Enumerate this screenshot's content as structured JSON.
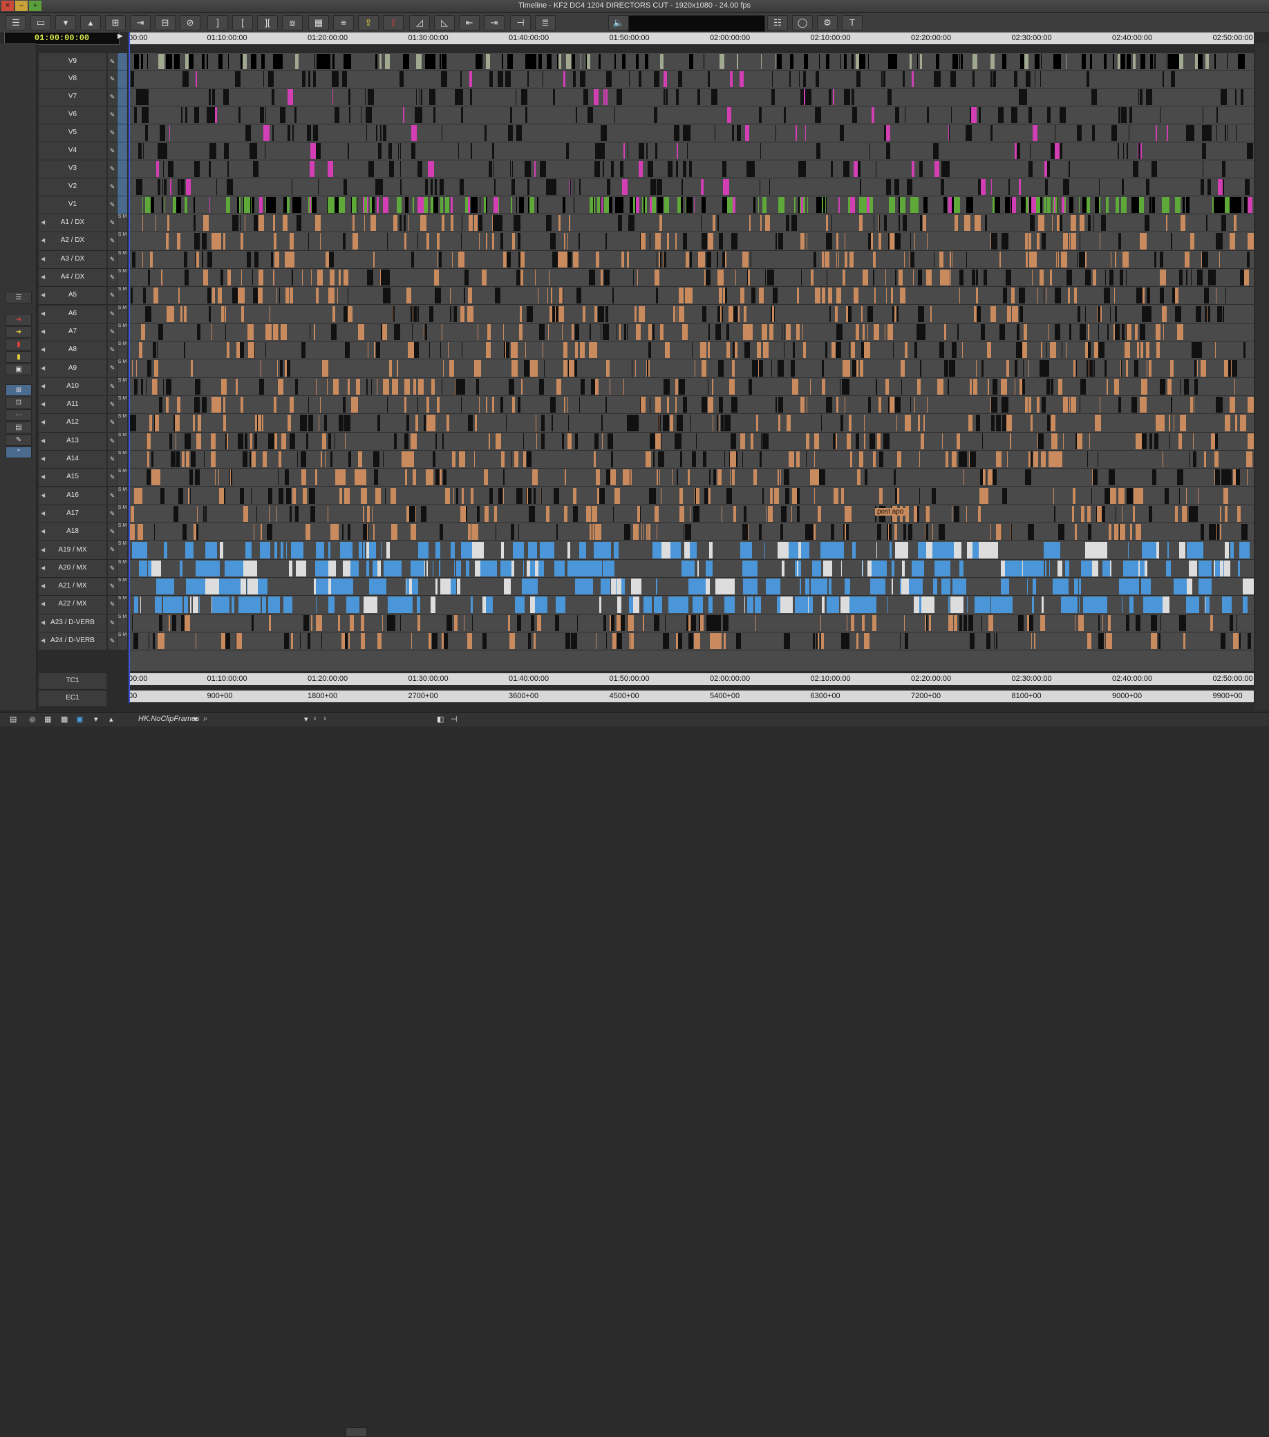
{
  "window": {
    "title": "Timeline - KF2 DC4 1204 DIRECTORS CUT - 1920x1080 - 24.00 fps"
  },
  "timecode": "01:00:00:00",
  "ruler": {
    "labels": [
      "00:00",
      "01:10:00:00",
      "01:20:00:00",
      "01:30:00:00",
      "01:40:00:00",
      "01:50:00:00",
      "02:00:00:00",
      "02:10:00:00",
      "02:20:00:00",
      "02:30:00:00",
      "02:40:00:00",
      "02:50:00:00"
    ]
  },
  "footage_ruler": {
    "labels": [
      "00",
      "900+00",
      "1800+00",
      "2700+00",
      "3600+00",
      "4500+00",
      "5400+00",
      "6300+00",
      "7200+00",
      "8100+00",
      "9000+00",
      "9900+00"
    ]
  },
  "tracks": [
    {
      "name": "V9",
      "kind": "v"
    },
    {
      "name": "V8",
      "kind": "v"
    },
    {
      "name": "V7",
      "kind": "v"
    },
    {
      "name": "V6",
      "kind": "v"
    },
    {
      "name": "V5",
      "kind": "v"
    },
    {
      "name": "V4",
      "kind": "v"
    },
    {
      "name": "V3",
      "kind": "v"
    },
    {
      "name": "V2",
      "kind": "v"
    },
    {
      "name": "V1",
      "kind": "v"
    },
    {
      "name": "A1 / DX",
      "kind": "a"
    },
    {
      "name": "A2 / DX",
      "kind": "a"
    },
    {
      "name": "A3 / DX",
      "kind": "a"
    },
    {
      "name": "A4 / DX",
      "kind": "a"
    },
    {
      "name": "A5",
      "kind": "a"
    },
    {
      "name": "A6",
      "kind": "a"
    },
    {
      "name": "A7",
      "kind": "a"
    },
    {
      "name": "A8",
      "kind": "a"
    },
    {
      "name": "A9",
      "kind": "a"
    },
    {
      "name": "A10",
      "kind": "a"
    },
    {
      "name": "A11",
      "kind": "a"
    },
    {
      "name": "A12",
      "kind": "a"
    },
    {
      "name": "A13",
      "kind": "a"
    },
    {
      "name": "A14",
      "kind": "a"
    },
    {
      "name": "A15",
      "kind": "a"
    },
    {
      "name": "A16",
      "kind": "a"
    },
    {
      "name": "A17",
      "kind": "a"
    },
    {
      "name": "A18",
      "kind": "a"
    },
    {
      "name": "A19 / MX",
      "kind": "mx"
    },
    {
      "name": "A20 / MX",
      "kind": "mx"
    },
    {
      "name": "A21 / MX",
      "kind": "mx"
    },
    {
      "name": "A22 / MX",
      "kind": "mx"
    },
    {
      "name": "A23 / D-VERB",
      "kind": "a"
    },
    {
      "name": "A24 / D-VERB",
      "kind": "a"
    }
  ],
  "aux_tracks": [
    "TC1",
    "EC1"
  ],
  "clip_label": "post apo",
  "status": {
    "clip_menu": "HK.NoClipFrames"
  },
  "colors": {
    "video": "#000000",
    "video_green": "#5fa83a",
    "video_magenta": "#d23fb5",
    "audio": "#c98a5e",
    "music": "#4a96d8",
    "filler": "#4a4a4a"
  }
}
